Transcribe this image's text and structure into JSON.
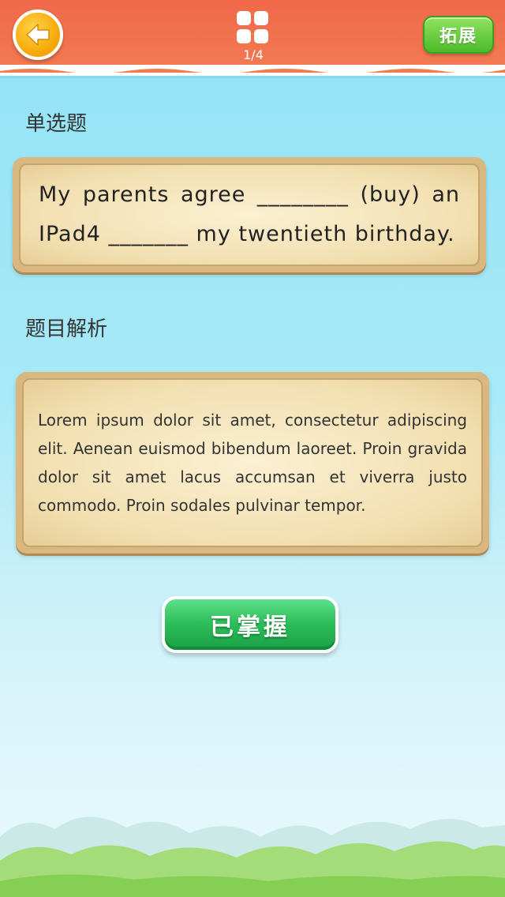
{
  "header": {
    "page_indicator": "1/4",
    "expand_label": "拓展"
  },
  "question": {
    "section_label": "单选题",
    "text": "My parents agree ________ (buy) an IPad4 _______ my twentieth birthday."
  },
  "analysis": {
    "section_label": "题目解析",
    "text": "Lorem ipsum dolor sit amet, consectetur adipiscing elit. Aenean euismod bibendum laoreet. Proin gravida dolor sit amet lacus accumsan et viverra justo commodo. Proin sodales pulvinar tempor."
  },
  "actions": {
    "mastered_label": "已掌握"
  },
  "colors": {
    "header": "#f0694a",
    "back_button": "#f5a400",
    "expand_button": "#4dbb2a",
    "mastered_button": "#2fbf5c",
    "card_border": "#d8b880",
    "sky": "#8fe3f5"
  },
  "icons": {
    "back": "back-arrow-icon",
    "menu": "grid-menu-icon"
  }
}
